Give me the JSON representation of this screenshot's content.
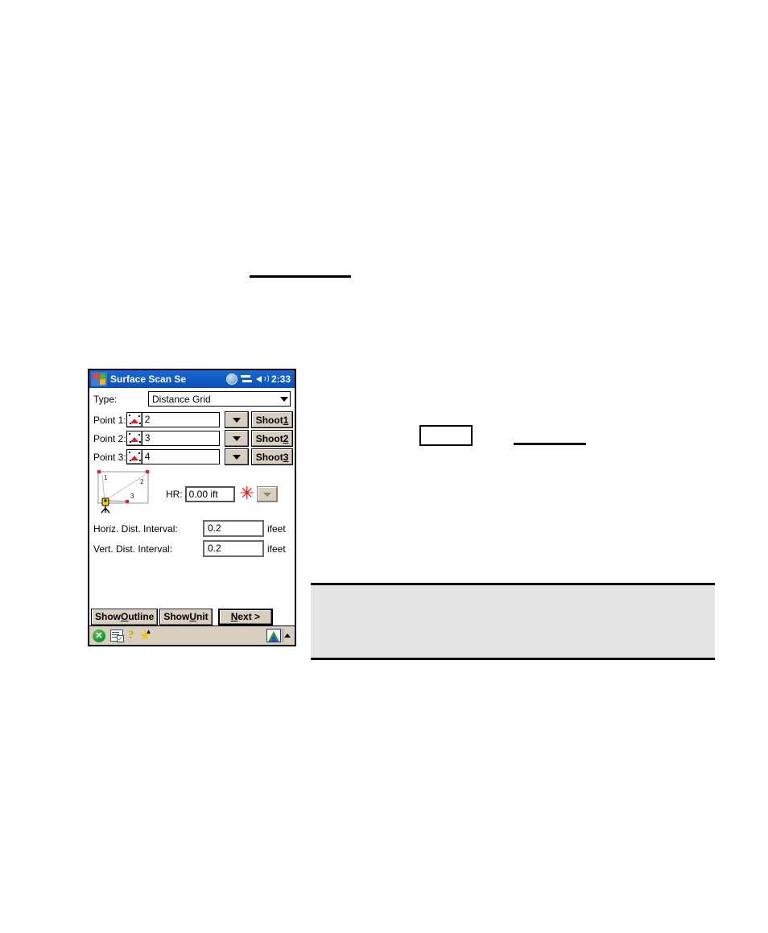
{
  "page": {
    "decorations": {
      "top_rule": "",
      "inline_box": "",
      "inline_rule": "",
      "gray_panel": ""
    }
  },
  "pda": {
    "titlebar": {
      "start_icon": "windows-logo-icon",
      "title": "Surface Scan Se",
      "icons": [
        "globe-icon",
        "connectivity-icon",
        "volume-icon"
      ],
      "clock": "2:33"
    },
    "type_row": {
      "label": "Type:",
      "value": "Distance Grid",
      "dropdown_icon": "chevron-down-icon"
    },
    "points": [
      {
        "label": "Point 1:",
        "picker_icon": "point-picker-icon",
        "value": "2",
        "dropdown_icon": "chevron-down-icon",
        "shoot_prefix": "Shoot ",
        "shoot_number": "1"
      },
      {
        "label": "Point 2:",
        "picker_icon": "point-picker-icon",
        "value": "3",
        "dropdown_icon": "chevron-down-icon",
        "shoot_prefix": "Shoot ",
        "shoot_number": "2"
      },
      {
        "label": "Point 3:",
        "picker_icon": "point-picker-icon",
        "value": "4",
        "dropdown_icon": "chevron-down-icon",
        "shoot_prefix": "Shoot ",
        "shoot_number": "3"
      }
    ],
    "diagram": {
      "name": "surface-scan-preview",
      "point_labels": [
        "1",
        "2",
        "3"
      ],
      "instrument_icon": "total-station-icon"
    },
    "hr_row": {
      "label": "HR:",
      "value": "0.00 ift",
      "asterisk_icon": "red-asterisk-icon",
      "dropdown_icon": "chevron-down-icon"
    },
    "intervals": [
      {
        "label": "Horiz. Dist. Interval:",
        "value": "0.2",
        "unit": "ifeet"
      },
      {
        "label": "Vert. Dist. Interval:",
        "value": "0.2",
        "unit": "ifeet"
      }
    ],
    "buttons": {
      "show_outline": {
        "pre": "Show ",
        "key": "O",
        "post": "utline"
      },
      "show_unit": {
        "pre": "Show ",
        "key": "U",
        "post": "nit"
      },
      "next": {
        "key": "N",
        "post": "ext >"
      }
    },
    "taskbar": {
      "close_icon": "close-circle-icon",
      "close_glyph": "✕",
      "tasks_icon": "task-list-icon",
      "tasks_check": "✓",
      "help_icon": "help-question-icon",
      "help_glyph": "?",
      "favorites_icon": "star-icon",
      "favorites_glyph": "★",
      "app_icon": "survey-app-icon",
      "expand_icon": "chevron-up-icon"
    }
  },
  "colors": {
    "titlebar": "#0b59c6",
    "button_face": "#d8cfc0",
    "accent_red": "#ff0000",
    "panel_gray": "#e4e4e4"
  }
}
